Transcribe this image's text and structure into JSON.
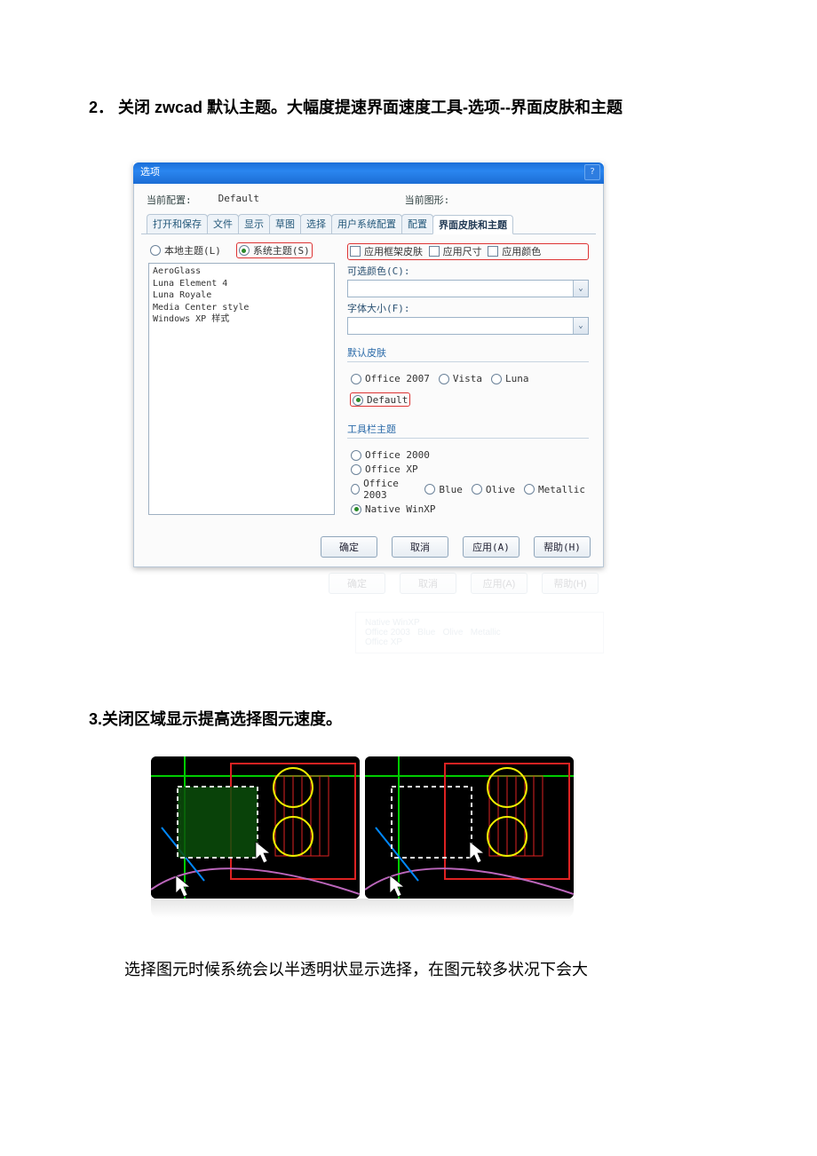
{
  "doc": {
    "section2_prefix": "2．",
    "section2_text": "关闭 zwcad 默认主题。大幅度提速界面速度工具-选项--界面皮肤和主题",
    "section3_prefix": "3.",
    "section3_text": "关闭区域显示提高选择图元速度。",
    "paragraph": "选择图元时候系统会以半透明状显示选择，在图元较多状况下会大"
  },
  "dialog": {
    "title": "选项",
    "help_glyph": "?",
    "profile_label": "当前配置:",
    "profile_value": "Default",
    "drawing_label": "当前图形:",
    "drawing_value": "",
    "tabs": [
      "打开和保存",
      "文件",
      "显示",
      "草图",
      "选择",
      "用户系统配置",
      "配置",
      "界面皮肤和主题"
    ],
    "active_tab_index": 7,
    "theme_mode": {
      "local": "本地主题(L)",
      "system": "系统主题(S)",
      "selected": "system"
    },
    "theme_list": [
      "AeroGlass",
      "Luna Element 4",
      "Luna Royale",
      "Media Center style",
      "Windows XP 样式"
    ],
    "apply_checks": {
      "frame": "应用框架皮肤",
      "size": "应用尺寸",
      "color": "应用颜色"
    },
    "color_label": "可选颜色(C):",
    "font_label": "字体大小(F):",
    "default_skin_group": "默认皮肤",
    "default_skin_options": [
      "Office 2007",
      "Vista",
      "Luna",
      "Default"
    ],
    "default_skin_selected": 3,
    "toolbar_group": "工具栏主题",
    "toolbar_options_col": [
      "Office 2000",
      "Office XP",
      "Office 2003",
      "Native WinXP"
    ],
    "toolbar_selected_col_index": 3,
    "office2003_variants": [
      "Blue",
      "Olive",
      "Metallic"
    ],
    "buttons": {
      "ok": "确定",
      "cancel": "取消",
      "apply": "应用(A)",
      "help": "帮助(H)"
    },
    "combo_arrow": "⌄"
  }
}
